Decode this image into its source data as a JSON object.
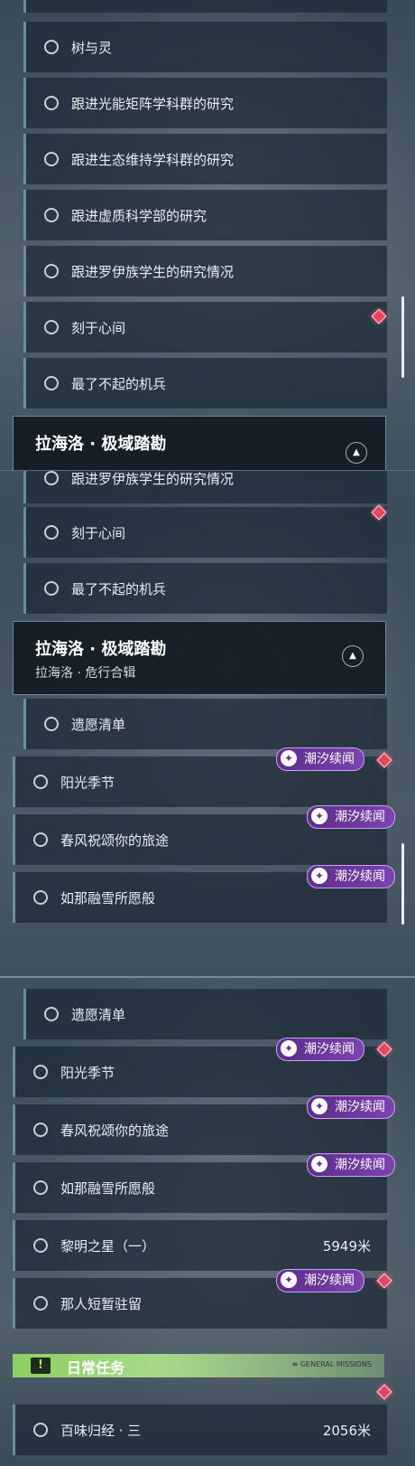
{
  "panel1": {
    "rows": [
      "树与灵",
      "跟进光能矩阵学科群的研究",
      "跟进生态维持学科群的研究",
      "跟进虚质科学部的研究",
      "跟进罗伊族学生的研究情况",
      "刻于心间",
      "最了不起的机兵"
    ],
    "header_title": "拉海洛 · 极域踏勘"
  },
  "panel2": {
    "partial_row": "跟进罗伊族学生的研究情况",
    "rows": [
      "刻于心间",
      "最了不起的机兵"
    ],
    "header_title": "拉海洛 · 极域踏勘",
    "header_subtitle": "拉海洛 · 危行合辑",
    "quests": [
      "遗愿清单",
      "阳光季节",
      "春风祝颂你的旅途",
      "如那融雪所愿般"
    ]
  },
  "panel3": {
    "quests": [
      "遗愿清单",
      "阳光季节",
      "春风祝颂你的旅途",
      "如那融雪所愿般",
      "黎明之星（一）",
      "那人短暂驻留"
    ],
    "distance_1": "5949米",
    "daily_title": "日常任务",
    "daily_badge": "!",
    "daily_small": "≡ GENERAL MISSIONS",
    "daily_quest": "百味归经 · 三",
    "distance_2": "2056米"
  },
  "tag_label": "潮汐续闻",
  "tag_icon": "tide-icon",
  "colors": {
    "tag": "#6f3aa3",
    "gem": "#e8465f",
    "daily": "#8ecf63",
    "header_bg": "#101820"
  }
}
